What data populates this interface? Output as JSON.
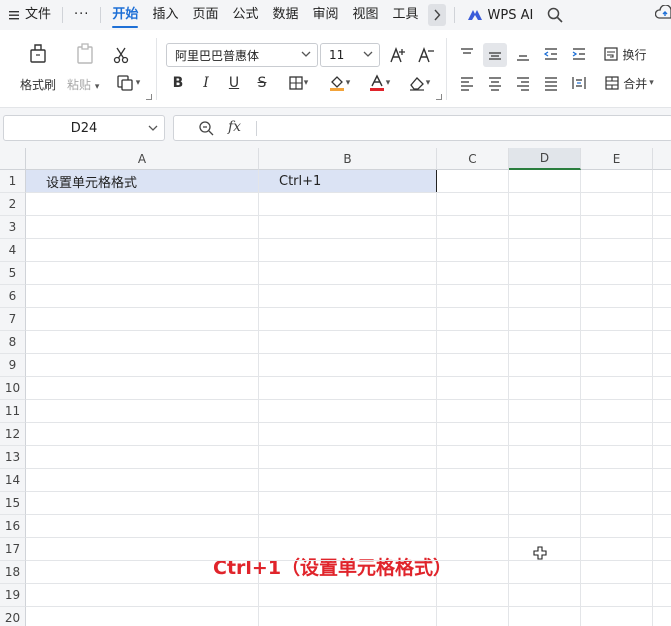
{
  "menubar": {
    "file_label": "文件",
    "more_label": "···",
    "tabs": [
      "开始",
      "插入",
      "页面",
      "公式",
      "数据",
      "审阅",
      "视图",
      "工具"
    ],
    "active_tab": "开始",
    "wps_ai_label": "WPS AI"
  },
  "ribbon": {
    "format_painter_label": "格式刷",
    "paste_label": "粘贴",
    "font_name": "阿里巴巴普惠体",
    "font_size": "11",
    "wrap_label": "换行",
    "merge_label": "合并",
    "bold": "B",
    "italic": "I",
    "underline": "U",
    "strike": "S"
  },
  "formula_bar": {
    "name_box": "D24",
    "fx_label": "fx",
    "formula": ""
  },
  "grid": {
    "columns": [
      "A",
      "B",
      "C",
      "D",
      "E"
    ],
    "selected_column": "D",
    "rows": [
      "1",
      "2",
      "3",
      "4",
      "5",
      "6",
      "7",
      "8",
      "9",
      "10",
      "11",
      "12",
      "13",
      "14",
      "15",
      "16",
      "17",
      "18",
      "19",
      "20"
    ],
    "cells": {
      "A1": "设置单元格格式",
      "B1": "Ctrl+1"
    }
  },
  "caption": "Ctrl+1（设置单元格格式）",
  "colors": {
    "accent": "#1d6fd6",
    "caption": "#e0242b",
    "header_fill": "#dbe3f4",
    "selected_column_underline": "#2a7d3e"
  }
}
